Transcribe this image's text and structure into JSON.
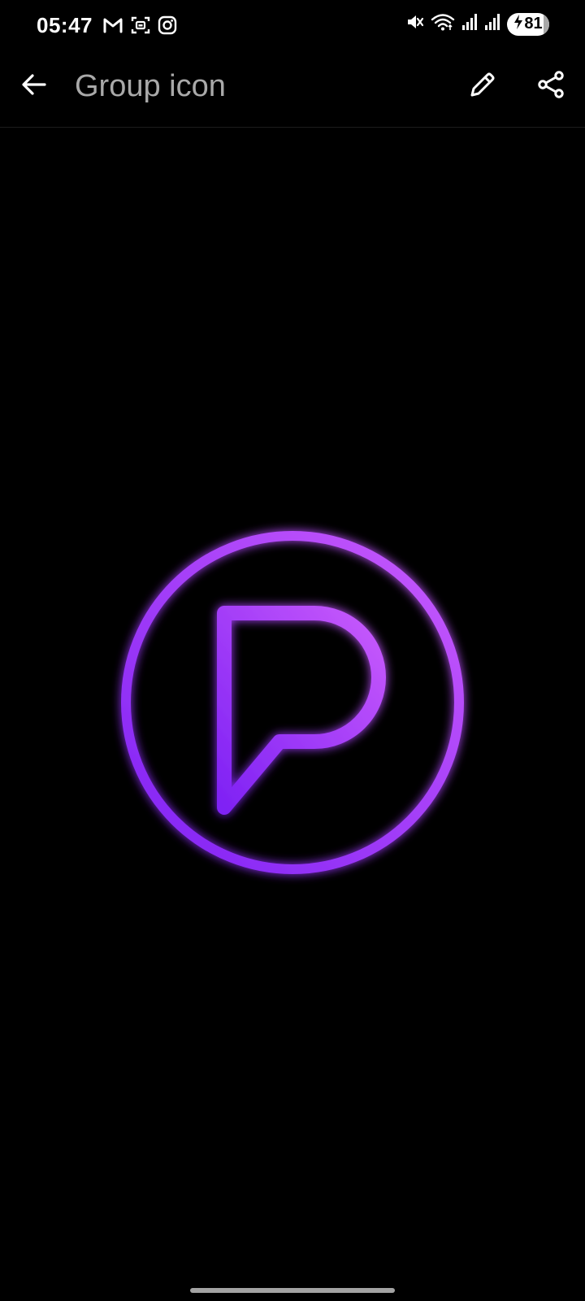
{
  "status_bar": {
    "time": "05:47",
    "notification_icons": [
      "gmail-icon",
      "screenshot-icon",
      "instagram-icon"
    ],
    "system_icons": [
      "mute-icon",
      "wifi-icon",
      "signal-icon",
      "signal-icon"
    ],
    "battery_level": "81",
    "battery_charging": true
  },
  "app_bar": {
    "title": "Group icon",
    "back_icon": "arrow-back-icon",
    "edit_icon": "pencil-icon",
    "share_icon": "share-icon"
  },
  "image": {
    "subject": "group-icon-image",
    "accent_start": "#8a2be2",
    "accent_end": "#cc55ff",
    "background": "#000000"
  }
}
